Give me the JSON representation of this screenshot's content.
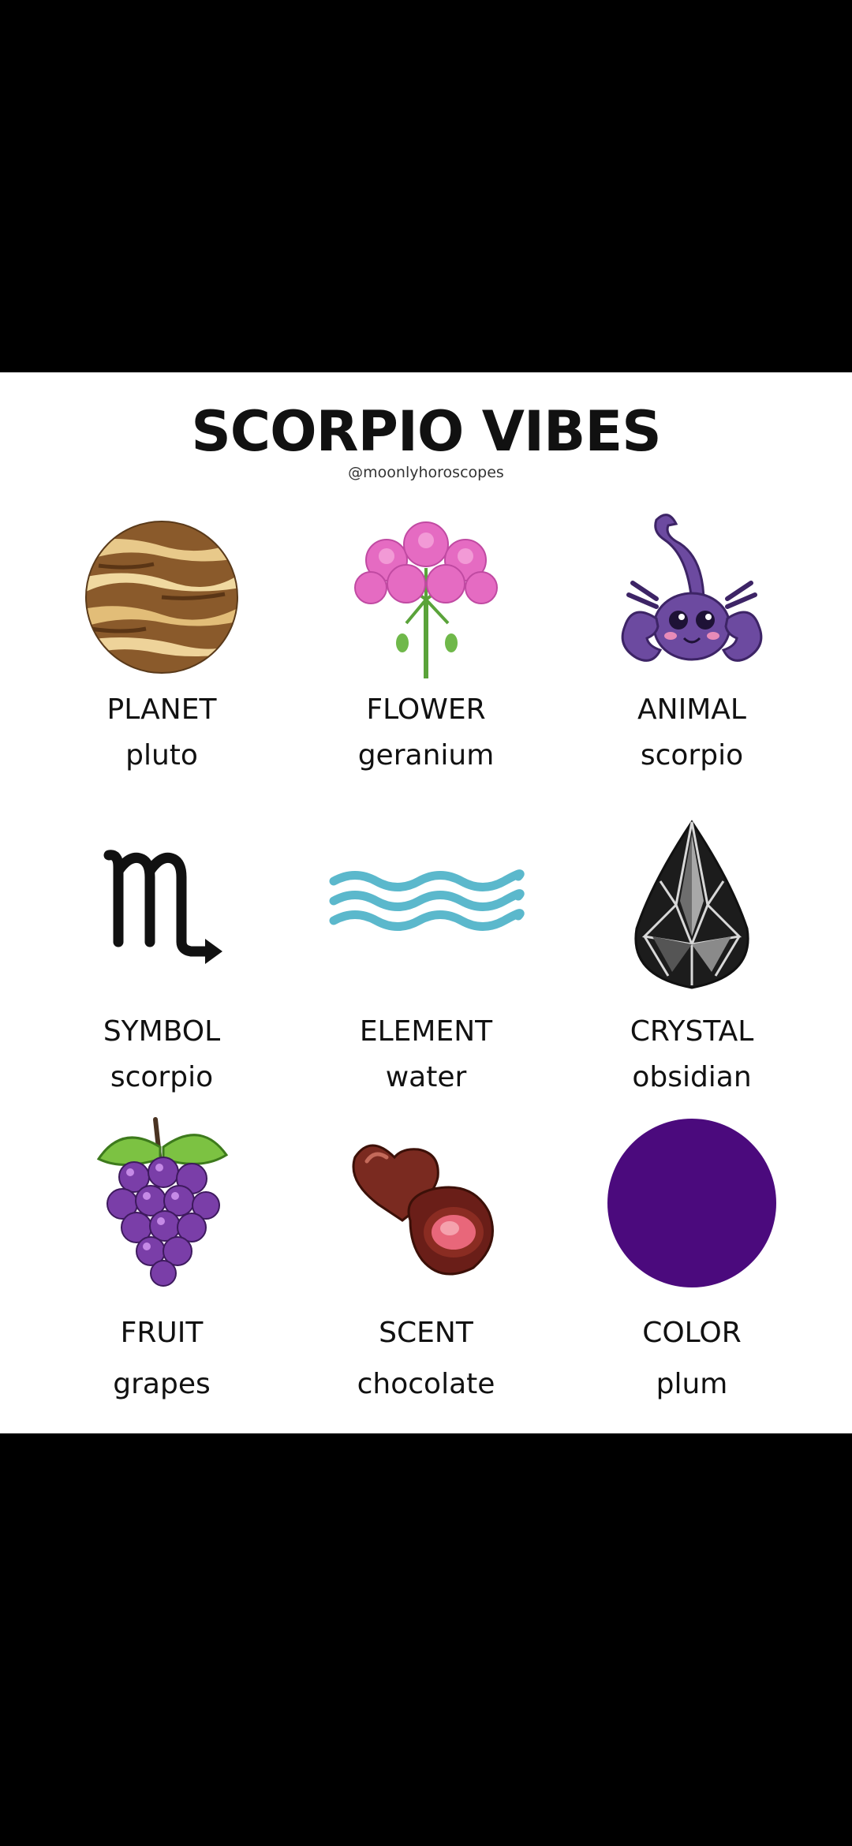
{
  "title": "SCORPIO VIBES",
  "handle": "@moonlyhoroscopes",
  "colors": {
    "page_background": "#000000",
    "card_background": "#ffffff",
    "plum": "#4b0a7d",
    "water": "#5bb8cc"
  },
  "items": [
    {
      "label": "PLANET",
      "value": "pluto",
      "icon": "planet-icon"
    },
    {
      "label": "FLOWER",
      "value": "geranium",
      "icon": "geranium-flower-icon"
    },
    {
      "label": "ANIMAL",
      "value": "scorpio",
      "icon": "scorpion-icon"
    },
    {
      "label": "SYMBOL",
      "value": "scorpio",
      "icon": "scorpio-glyph-icon"
    },
    {
      "label": "ELEMENT",
      "value": "water",
      "icon": "water-waves-icon"
    },
    {
      "label": "CRYSTAL",
      "value": "obsidian",
      "icon": "crystal-icon"
    },
    {
      "label": "FRUIT",
      "value": "grapes",
      "icon": "grapes-icon"
    },
    {
      "label": "SCENT",
      "value": "chocolate",
      "icon": "chocolate-icon"
    },
    {
      "label": "COLOR",
      "value": "plum",
      "icon": "plum-color-swatch-icon"
    }
  ]
}
